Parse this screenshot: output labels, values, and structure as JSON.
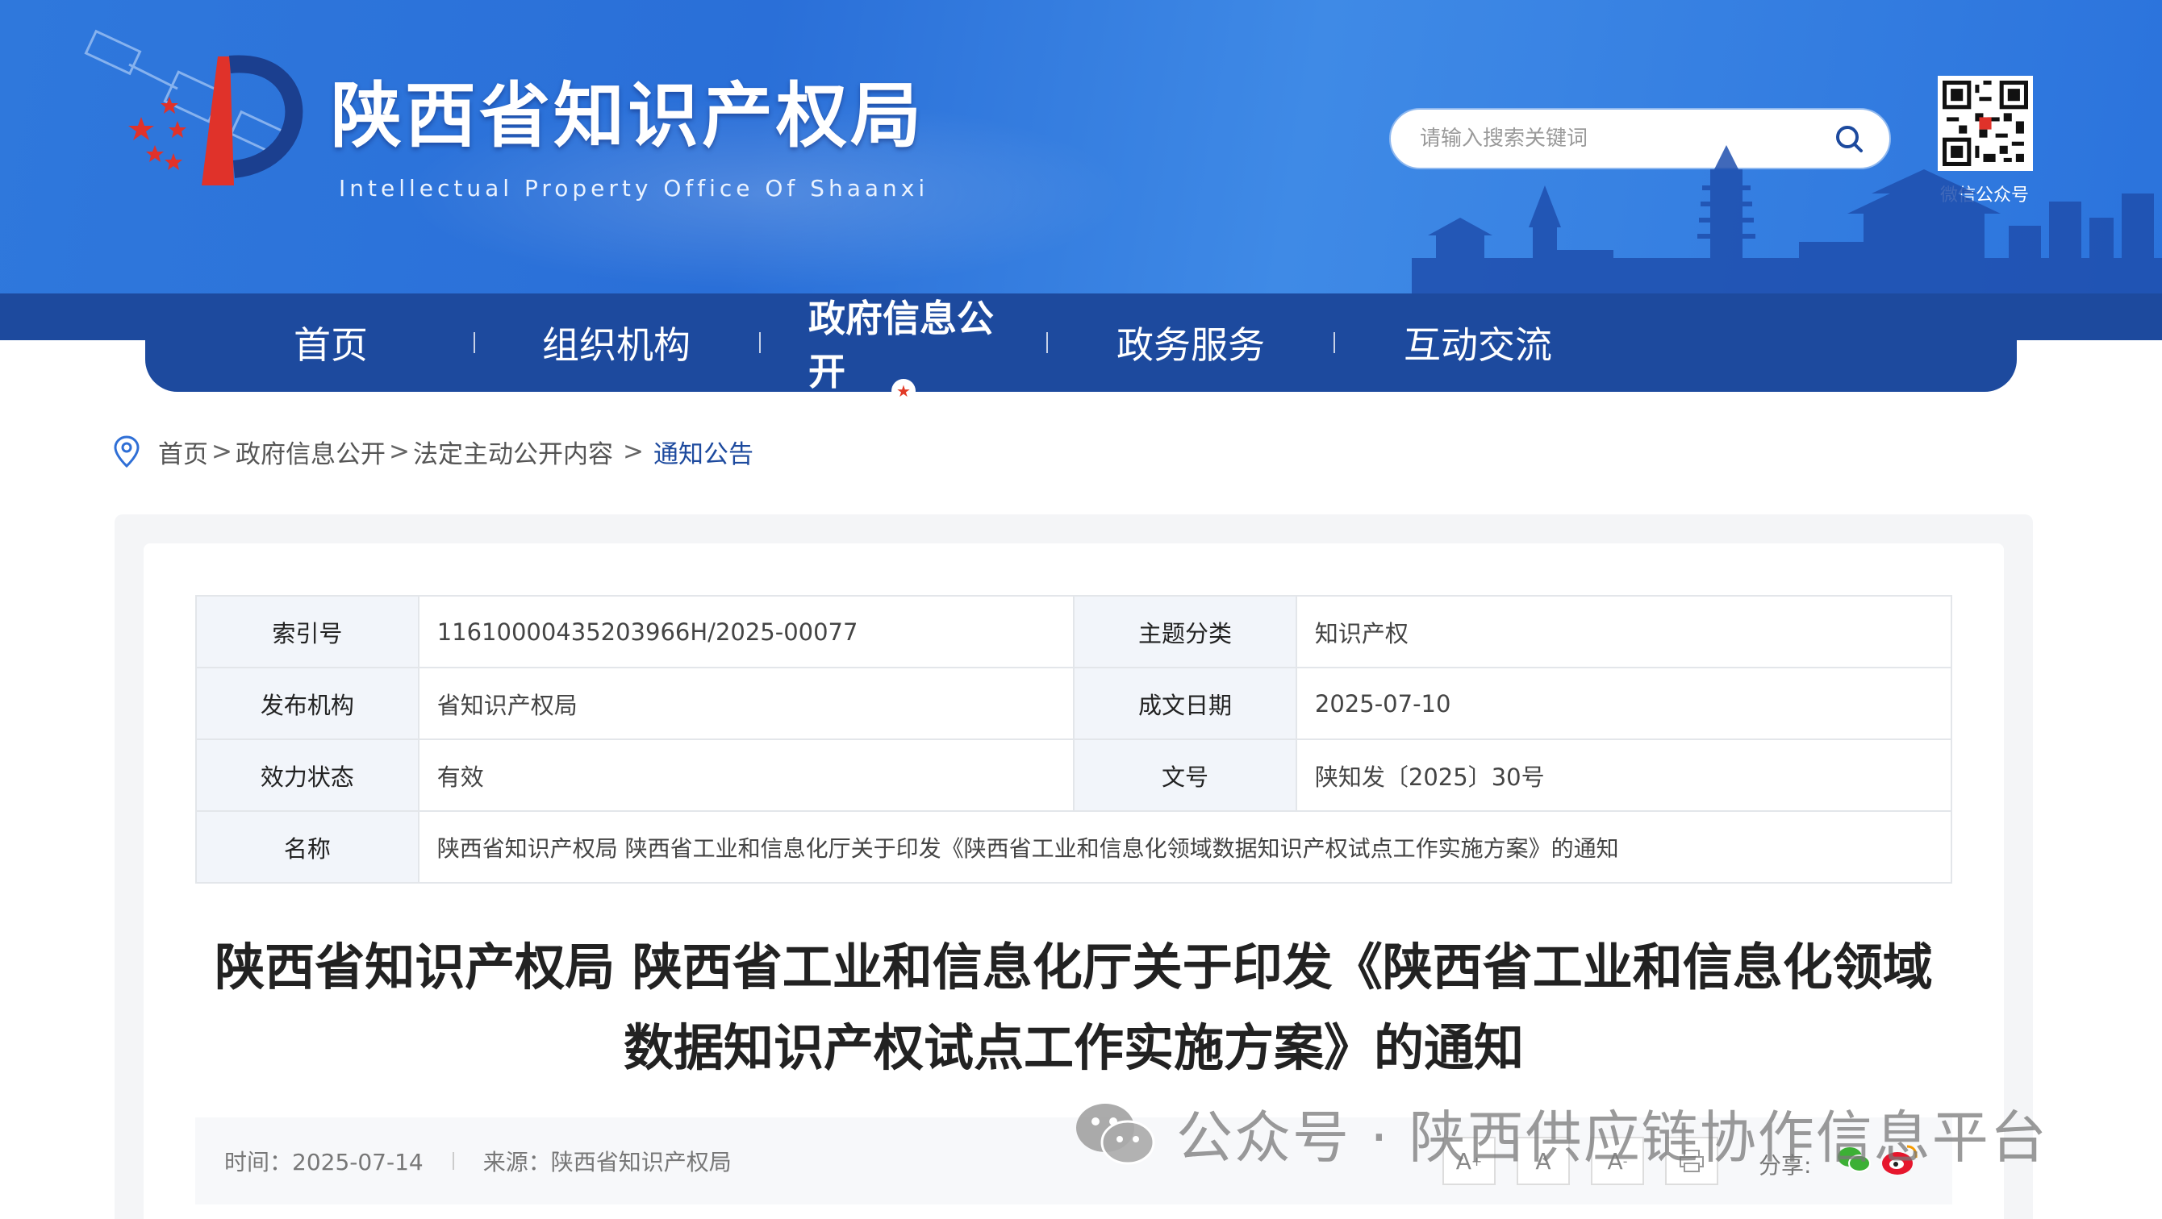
{
  "header": {
    "title": "陕西省知识产权局",
    "subtitle": "Intellectual Property Office Of Shaanxi",
    "search_placeholder": "请输入搜索关键词",
    "qr_label": "微信公众号"
  },
  "nav": {
    "items": [
      {
        "label": "首页"
      },
      {
        "label": "组织机构"
      },
      {
        "label": "政府信息公开",
        "active": true
      },
      {
        "label": "政务服务"
      },
      {
        "label": "互动交流"
      }
    ]
  },
  "breadcrumb": {
    "items": [
      "首页",
      "政府信息公开",
      "法定主动公开内容"
    ],
    "current": "通知公告",
    "separator": ">"
  },
  "meta": {
    "index_label": "索引号",
    "index_value": "11610000435203966H/2025-00077",
    "topic_label": "主题分类",
    "topic_value": "知识产权",
    "publisher_label": "发布机构",
    "publisher_value": "省知识产权局",
    "date_label": "成文日期",
    "date_value": "2025-07-10",
    "status_label": "效力状态",
    "status_value": "有效",
    "docno_label": "文号",
    "docno_value": "陕知发〔2025〕30号",
    "name_label": "名称",
    "name_value": "陕西省知识产权局 陕西省工业和信息化厅关于印发《陕西省工业和信息化领域数据知识产权试点工作实施方案》的通知"
  },
  "article": {
    "title_line1": "陕西省知识产权局 陕西省工业和信息化厅关于印发《陕西省工业和信息化领域",
    "title_line2": "数据知识产权试点工作实施方案》的通知",
    "time": "时间：2025-07-14",
    "source": "来源：陕西省知识产权局",
    "font_large": "A",
    "font_medium": "A",
    "font_small": "A",
    "share_label": "分享:"
  },
  "watermark": {
    "text": "公众号 · 陕西供应链协作信息平台"
  },
  "colors": {
    "header_blue": "#2f78dc",
    "nav_blue": "#1d4a9e",
    "accent_red": "#e23a27"
  }
}
